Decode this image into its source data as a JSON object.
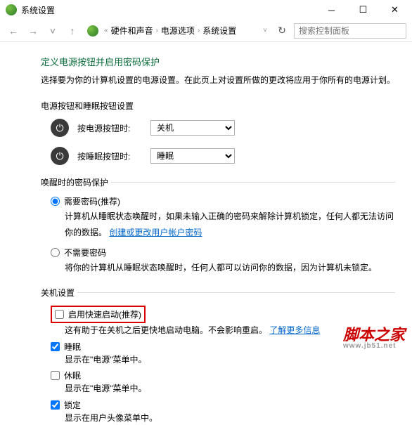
{
  "window": {
    "title": "系统设置"
  },
  "breadcrumb": {
    "root_icon": "control-panel",
    "items": [
      "硬件和声音",
      "电源选项",
      "系统设置"
    ]
  },
  "search": {
    "placeholder": "搜索控制面板"
  },
  "page": {
    "heading": "定义电源按钮并启用密码保护",
    "subheading": "选择要为你的计算机设置的电源设置。在此页上对设置所做的更改将应用于你所有的电源计划。"
  },
  "section_buttons": {
    "label": "电源按钮和睡眠按钮设置",
    "rows": [
      {
        "label": "按电源按钮时:",
        "value": "关机"
      },
      {
        "label": "按睡眠按钮时:",
        "value": "睡眠"
      }
    ]
  },
  "section_wake": {
    "label": "唤醒时的密码保护",
    "options": [
      {
        "title": "需要密码(推荐)",
        "checked": true,
        "body_pre": "计算机从睡眠状态唤醒时，如果未输入正确的密码来解除计算机锁定，任何人都无法访问你的数据。",
        "link": "创建或更改用户帐户密码"
      },
      {
        "title": "不需要密码",
        "checked": false,
        "body_pre": "将你的计算机从睡眠状态唤醒时，任何人都可以访问你的数据，因为计算机未锁定。"
      }
    ]
  },
  "section_shutdown": {
    "label": "关机设置",
    "items": [
      {
        "title": "启用快速启动(推荐)",
        "checked": false,
        "highlighted": true,
        "body": "这有助于在关机之后更快地启动电脑。不会影响重启。",
        "link": "了解更多信息"
      },
      {
        "title": "睡眠",
        "checked": true,
        "body": "显示在\"电源\"菜单中。"
      },
      {
        "title": "休眠",
        "checked": false,
        "body": "显示在\"电源\"菜单中。"
      },
      {
        "title": "锁定",
        "checked": true,
        "body": "显示在用户头像菜单中。"
      }
    ]
  },
  "watermark": {
    "main": "脚本之家",
    "sub": "www.jb51.net"
  }
}
